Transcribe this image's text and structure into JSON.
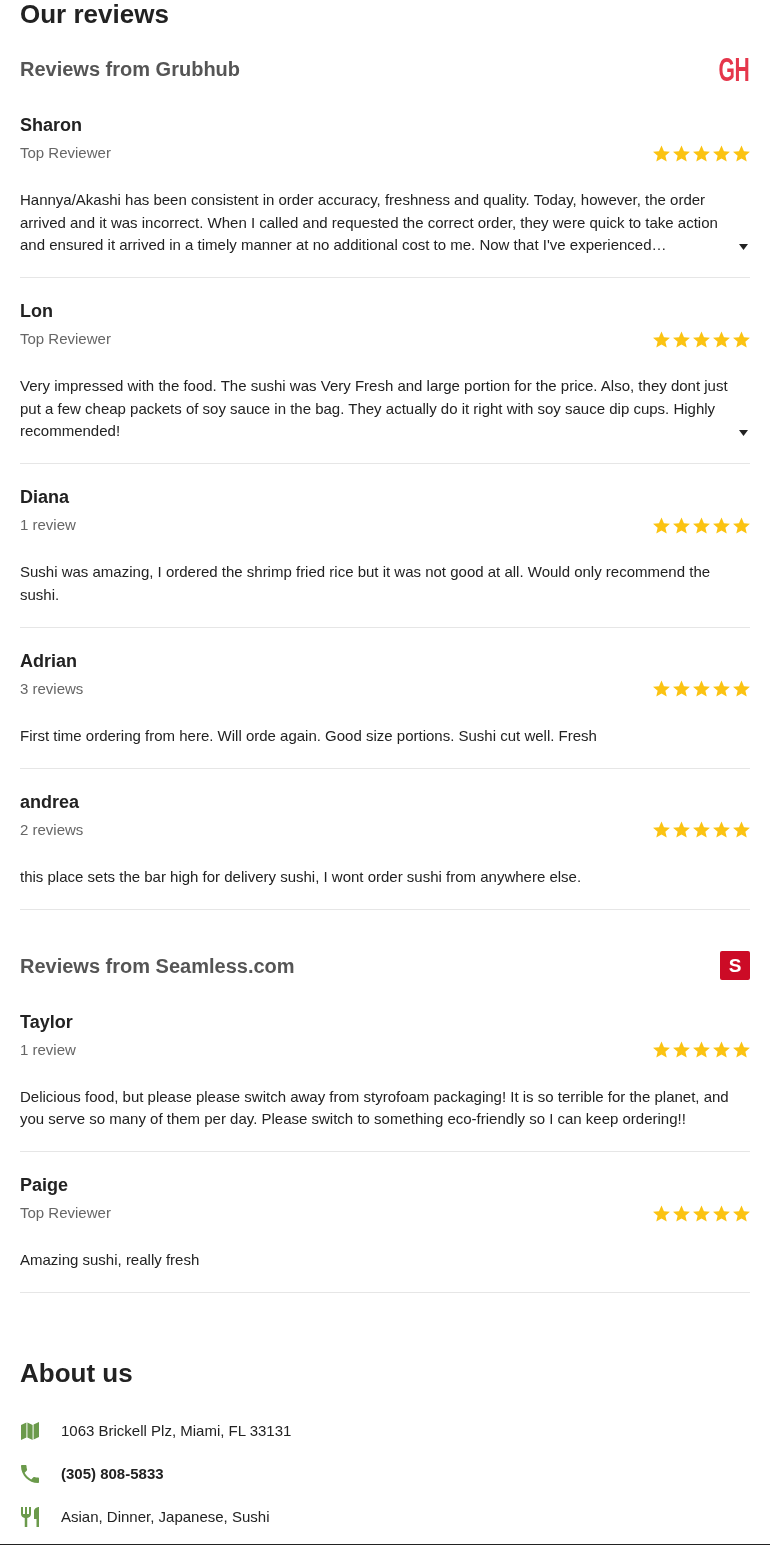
{
  "page_title": "Our reviews",
  "review_sources": [
    {
      "title": "Reviews from Grubhub",
      "logo_text": "GH",
      "kind": "wordmark",
      "reviews": [
        {
          "name": "Sharon",
          "subtitle": "Top Reviewer",
          "stars": 5,
          "text": "Hannya/Akashi has been consistent in order accuracy, freshness and quality. Today, however, the order arrived and it was incorrect. When I called and requested the correct order, they were quick to take action and ensured it arrived in a timely manner at no additional cost to me. Now that I've experienced…",
          "expandable": true
        },
        {
          "name": "Lon",
          "subtitle": "Top Reviewer",
          "stars": 5,
          "text": "Very impressed with the food. The sushi was Very Fresh and large portion for the price. Also, they dont just put a few cheap packets of soy sauce in the bag. They actually do it right with soy sauce dip cups. Highly recommended!",
          "expandable": true
        },
        {
          "name": "Diana",
          "subtitle": "1 review",
          "stars": 5,
          "text": "Sushi was amazing, I ordered the shrimp fried rice but it was not good at all. Would only recommend the sushi.",
          "expandable": false
        },
        {
          "name": "Adrian",
          "subtitle": "3 reviews",
          "stars": 5,
          "text": "First time ordering from here. Will orde again. Good size portions. Sushi cut well. Fresh",
          "expandable": false
        },
        {
          "name": "andrea",
          "subtitle": "2 reviews",
          "stars": 5,
          "text": "this place sets the bar high for delivery sushi, I wont order sushi from anywhere else.",
          "expandable": false
        }
      ]
    },
    {
      "title": "Reviews from Seamless.com",
      "logo_text": "S",
      "kind": "tile",
      "reviews": [
        {
          "name": "Taylor",
          "subtitle": "1 review",
          "stars": 5,
          "text": "Delicious food, but please please switch away from styrofoam packaging! It is so terrible for the planet, and you serve so many of them per day. Please switch to something eco-friendly so I can keep ordering!!",
          "expandable": false
        },
        {
          "name": "Paige",
          "subtitle": "Top Reviewer",
          "stars": 5,
          "text": "Amazing sushi, really fresh",
          "expandable": false
        }
      ]
    }
  ],
  "about": {
    "title": "About us",
    "items": [
      {
        "kind": "address",
        "text": "1063 Brickell Plz, Miami, FL 33131"
      },
      {
        "kind": "phone",
        "text": "(305) 808-5833"
      },
      {
        "kind": "cuisine",
        "text": "Asian, Dinner, Japanese, Sushi"
      }
    ]
  }
}
